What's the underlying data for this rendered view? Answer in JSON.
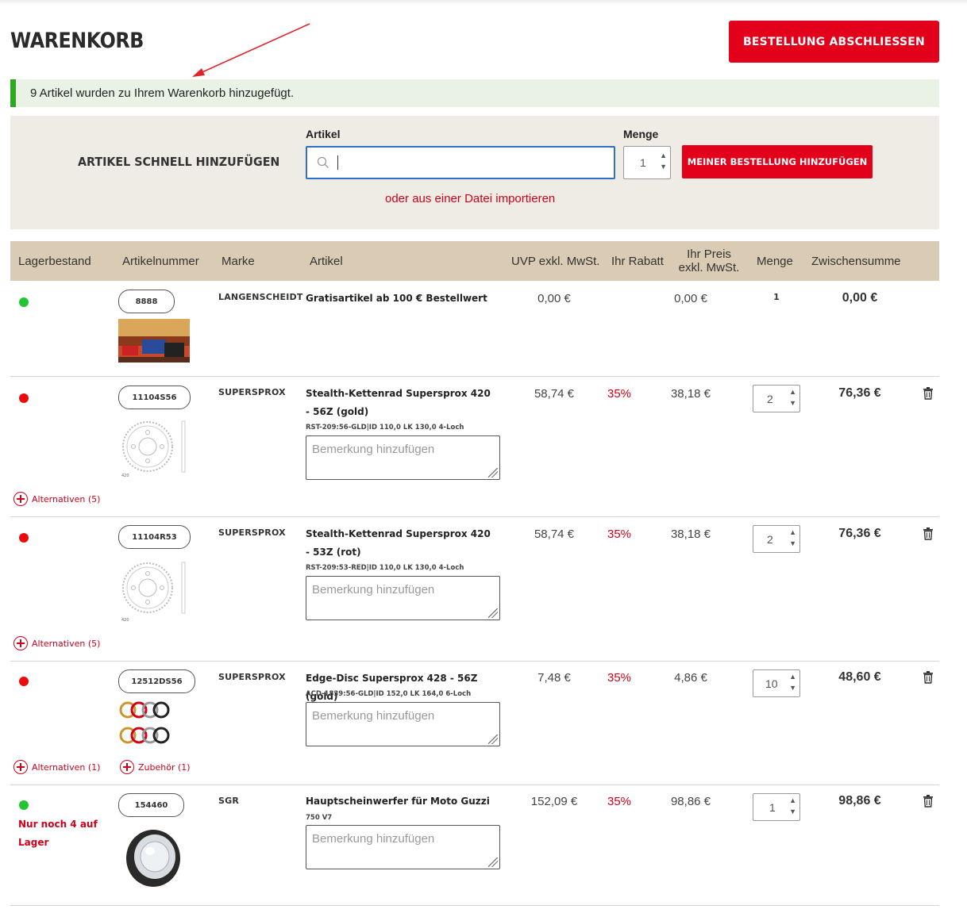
{
  "page": {
    "title": "WARENKORB",
    "checkout_label": "BESTELLUNG ABSCHLIESSEN",
    "notice": "9 Artikel wurden zu Ihrem Warenkorb hinzugefügt."
  },
  "quick_add": {
    "title": "ARTIKEL SCHNELL HINZUFÜGEN",
    "artikel_label": "Artikel",
    "menge_label": "Menge",
    "menge_value": "1",
    "add_label": "MEINER BESTELLUNG HINZUFÜGEN",
    "import_link": "oder aus einer Datei importieren"
  },
  "table": {
    "headers": {
      "lagerbestand": "Lagerbestand",
      "artikelnummer": "Artikelnummer",
      "marke": "Marke",
      "artikel": "Artikel",
      "uvp": "UVP exkl. MwSt.",
      "rabatt": "Ihr Rabatt",
      "preis": "Ihr Preis exkl. MwSt.",
      "menge": "Menge",
      "zwischensumme": "Zwischensumme"
    },
    "remark_placeholder": "Bemerkung hinzufügen",
    "rows": [
      {
        "stock": "green",
        "sku": "8888",
        "brand": "LANGENSCHEIDT",
        "name": "Gratisartikel ab 100 € Bestellwert",
        "uvp": "0,00 €",
        "price": "0,00 €",
        "qty": "1",
        "subtotal": "0,00 €"
      },
      {
        "stock": "red",
        "sku": "11104S56",
        "brand": "SUPERSPROX",
        "name": "Stealth-Kettenrad Supersprox 420 - 56Z (gold)",
        "desc": "RST-209:56-GLD|ID 110,0 LK 130,0 4-Loch",
        "uvp": "58,74 €",
        "rabatt": "35%",
        "price": "38,18 €",
        "qty": "2",
        "subtotal": "76,36 €",
        "alt_link": "Alternativen (5)"
      },
      {
        "stock": "red",
        "sku": "11104R53",
        "brand": "SUPERSPROX",
        "name": "Stealth-Kettenrad Supersprox 420 - 53Z (rot)",
        "desc": "RST-209:53-RED|ID 110,0 LK 130,0 4-Loch",
        "uvp": "58,74 €",
        "rabatt": "35%",
        "price": "38,18 €",
        "qty": "2",
        "subtotal": "76,36 €",
        "alt_link": "Alternativen (5)"
      },
      {
        "stock": "red",
        "sku": "12512DS56",
        "brand": "SUPERSPROX",
        "name": "Edge-Disc Supersprox 428 - 56Z (gold)",
        "desc": "ACD-1839:56-GLD|ID 152,0 LK 164,0 6-Loch",
        "uvp": "7,48 €",
        "rabatt": "35%",
        "price": "4,86 €",
        "qty": "10",
        "subtotal": "48,60 €",
        "alt_link": "Alternativen (1)",
        "acc_link": "Zubehör (1)"
      },
      {
        "stock": "green",
        "stock_note": "Nur noch 4 auf Lager",
        "sku": "154460",
        "brand": "SGR",
        "name": "Hauptscheinwerfer für Moto Guzzi",
        "desc": "750 V7",
        "uvp": "152,09 €",
        "rabatt": "35%",
        "price": "98,86 €",
        "qty": "1",
        "subtotal": "98,86 €"
      }
    ]
  },
  "colors": {
    "brand_red": "#e2001a",
    "notice_green": "#2fa81f",
    "header_beige": "#d9cbb4",
    "panel_beige": "#efebe5",
    "input_blue": "#2e6fc9"
  },
  "icons": [
    "search-icon",
    "trash-icon",
    "circle-plus-icon",
    "spinner-arrows-icon",
    "resize-grip-icon",
    "red-annotation-arrow"
  ]
}
